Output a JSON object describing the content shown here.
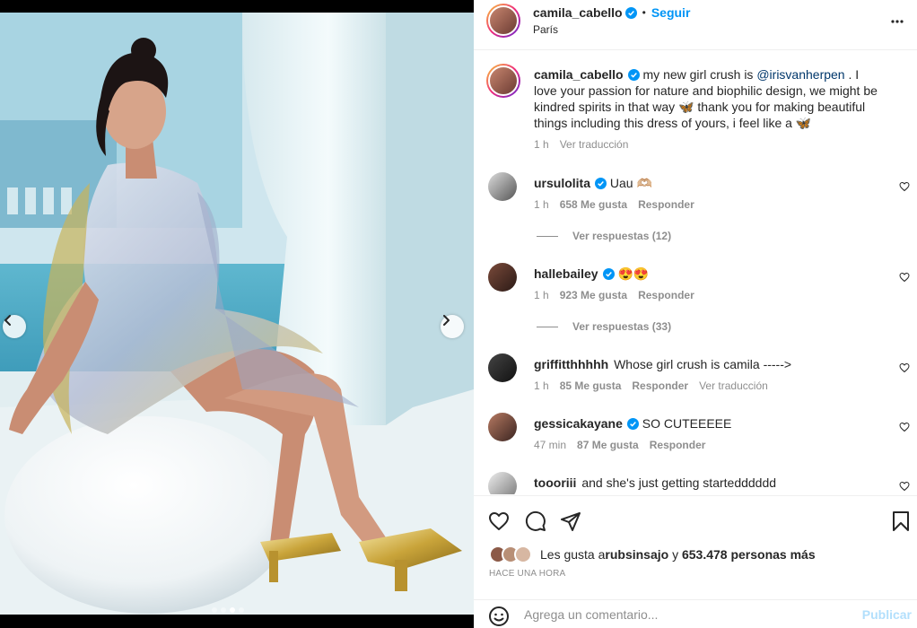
{
  "post": {
    "author": "camila_cabello",
    "follow_label": "Seguir",
    "separator": "•",
    "location": "París"
  },
  "caption": {
    "author": "camila_cabello",
    "text_before": "my new girl crush is ",
    "mention": "@irisvanherpen",
    "text_after": " . I love your passion for nature and biophilic design, we might be kindred spirits in that way 🦋 thank you for making beautiful things including this dress of yours, i feel like a 🦋",
    "time": "1 h",
    "translate": "Ver traducción"
  },
  "comments": [
    {
      "user": "ursulolita",
      "verified": true,
      "text": "Uau 🫶🏼",
      "time": "1 h",
      "likes": "658 Me gusta",
      "reply": "Responder",
      "view_replies": "Ver respuestas (12)"
    },
    {
      "user": "hallebailey",
      "verified": true,
      "text": "😍😍",
      "time": "1 h",
      "likes": "923 Me gusta",
      "reply": "Responder",
      "view_replies": "Ver respuestas (33)"
    },
    {
      "user": "griffitthhhhh",
      "verified": false,
      "text": "Whose girl crush is camila ----->",
      "time": "1 h",
      "likes": "85 Me gusta",
      "reply": "Responder",
      "translate": "Ver traducción"
    },
    {
      "user": "gessicakayane",
      "verified": true,
      "text": "SO CUTEEEEE",
      "time": "47 min",
      "likes": "87 Me gusta",
      "reply": "Responder"
    },
    {
      "user": "toooriii",
      "verified": false,
      "text": "and she's just getting startedddddd"
    }
  ],
  "likes_line": {
    "prefix": "Les gusta a ",
    "user": "rubsinsajo",
    "middle": " y ",
    "count": "653.478 personas más"
  },
  "timestamp": "HACE UNA HORA",
  "comment_box": {
    "placeholder": "Agrega un comentario...",
    "post_label": "Publicar"
  },
  "carousel": {
    "slides": 4,
    "active_index": 2
  },
  "colors": {
    "accent": "#0095f6",
    "verified": "#0095f6",
    "muted": "#8e8e8e",
    "text": "#262626"
  },
  "icons": [
    "chevron-left-icon",
    "chevron-right-icon",
    "more-icon",
    "verified-icon",
    "heart-icon",
    "comment-icon",
    "share-icon",
    "bookmark-icon",
    "emoji-icon"
  ]
}
